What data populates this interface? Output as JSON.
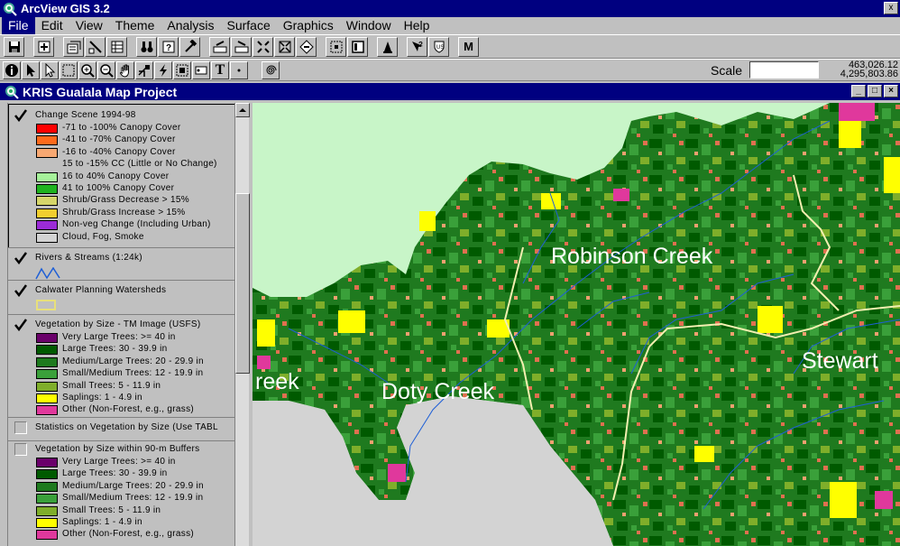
{
  "app": {
    "title": "ArcView GIS 3.2",
    "close_glyph": "x"
  },
  "menu": [
    "File",
    "Edit",
    "View",
    "Theme",
    "Analysis",
    "Surface",
    "Graphics",
    "Window",
    "Help"
  ],
  "toolbar": {
    "scale_label": "Scale",
    "scale_value": "",
    "coord_x": "463,026.12",
    "coord_y": "4,295,803.86",
    "text_tool": "T",
    "m_button": "M"
  },
  "project": {
    "title": "KRIS Gualala Map Project",
    "min": "_",
    "max": "□",
    "close": "×"
  },
  "toc": {
    "themes": [
      {
        "name": "Change Scene 1994-98",
        "checked": true,
        "legend": [
          {
            "label": "-71 to -100% Canopy Cover",
            "color": "#ff0000"
          },
          {
            "label": "-41 to -70% Canopy Cover",
            "color": "#ff6a1c"
          },
          {
            "label": "-16 to -40% Canopy Cover",
            "color": "#f7a872"
          },
          {
            "label": "15 to -15% CC (Little or No Change)",
            "color": ""
          },
          {
            "label": "16 to 40% Canopy Cover",
            "color": "#a6f29a"
          },
          {
            "label": "41 to 100% Canopy Cover",
            "color": "#1fb31f"
          },
          {
            "label": "Shrub/Grass Decrease > 15%",
            "color": "#d6d66a"
          },
          {
            "label": "Shrub/Grass Increase > 15%",
            "color": "#f2ce2e"
          },
          {
            "label": "Non-veg Change (Including Urban)",
            "color": "#9b2bd6"
          },
          {
            "label": "Cloud, Fog, Smoke",
            "color": "#d3d3d3"
          }
        ]
      },
      {
        "name": "Rivers & Streams (1:24k)",
        "checked": true,
        "legend": []
      },
      {
        "name": "Calwater Planning Watersheds",
        "checked": true,
        "legend": []
      },
      {
        "name": "Vegetation by Size - TM Image (USFS)",
        "checked": true,
        "legend": [
          {
            "label": "Very Large Trees: >= 40  in",
            "color": "#6a006a"
          },
          {
            "label": "Large Trees: 30 - 39.9 in",
            "color": "#005a00"
          },
          {
            "label": "Medium/Large Trees: 20 - 29.9 in",
            "color": "#1e7a1e"
          },
          {
            "label": "Small/Medium Trees: 12 - 19.9 in",
            "color": "#3aa03a"
          },
          {
            "label": "Small Trees: 5 - 11.9 in",
            "color": "#7fae2a"
          },
          {
            "label": "Saplings: 1 - 4.9 in",
            "color": "#ffff00"
          },
          {
            "label": "Other (Non-Forest, e.g., grass)",
            "color": "#e0389c"
          }
        ]
      },
      {
        "name": "Statistics on Vegetation by Size (Use TABL",
        "checked": false,
        "legend": []
      },
      {
        "name": "Vegetation by Size within 90-m Buffers",
        "checked": false,
        "legend": [
          {
            "label": "Very Large Trees: >= 40  in",
            "color": "#6a006a"
          },
          {
            "label": "Large Trees: 30 - 39.9 in",
            "color": "#005a00"
          },
          {
            "label": "Medium/Large Trees: 20 - 29.9 in",
            "color": "#1e7a1e"
          },
          {
            "label": "Small/Medium Trees: 12 - 19.9 in",
            "color": "#3aa03a"
          },
          {
            "label": "Small Trees: 5 - 11.9 in",
            "color": "#7fae2a"
          },
          {
            "label": "Saplings: 1 - 4.9 in",
            "color": "#ffff00"
          },
          {
            "label": "Other (Non-Forest, e.g., grass)",
            "color": "#e0389c"
          }
        ]
      }
    ]
  },
  "map": {
    "labels": {
      "robinson": "Robinson Creek",
      "doty": "Doty Creek",
      "stewart": "Stewart",
      "reek": "reek"
    }
  }
}
